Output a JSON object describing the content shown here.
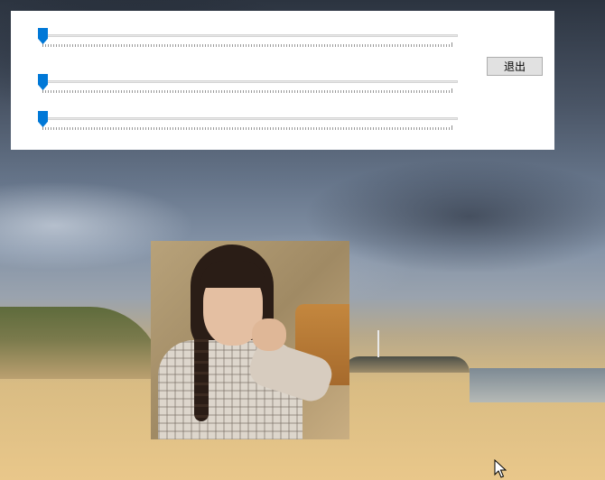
{
  "window": {
    "sliders": [
      {
        "value": 0
      },
      {
        "value": 0
      },
      {
        "value": 0
      }
    ],
    "exit_label": "退出"
  },
  "colors": {
    "accent": "#0078d7",
    "panel_bg": "#ffffff",
    "button_bg": "#e1e1e1"
  },
  "icons": {
    "pointer": "mouse-pointer-icon"
  }
}
